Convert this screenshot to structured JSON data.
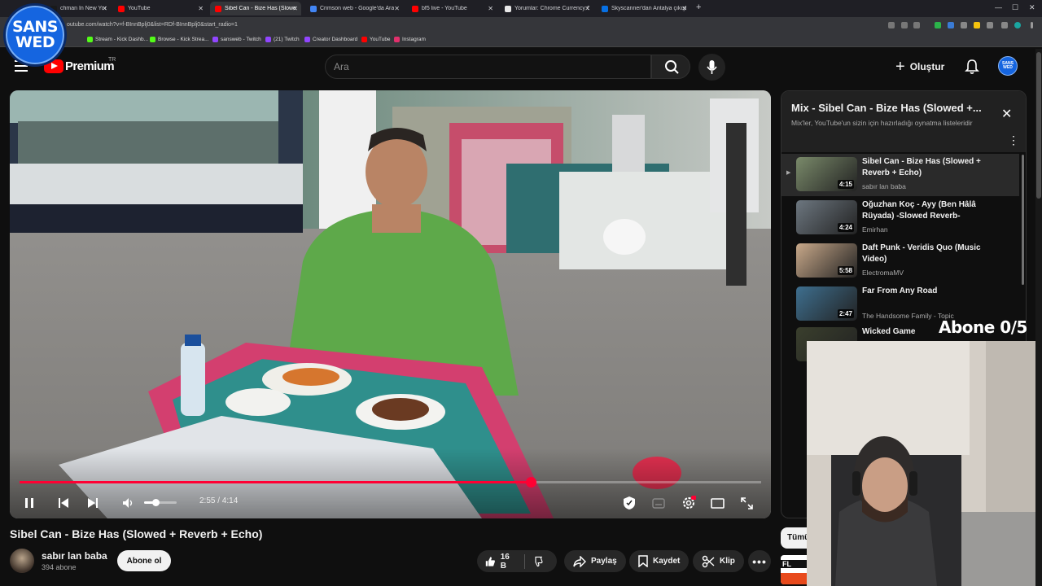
{
  "browser": {
    "tabs": [
      {
        "title": "chman In New Yor",
        "color": "#1a1a1a"
      },
      {
        "title": "YouTube",
        "color": "#ff0000"
      },
      {
        "title": "Sibel Can - Bize Has (Slowe",
        "color": "#ff0000"
      },
      {
        "title": "Crimson web - Google'da Ara",
        "color": "#4285f4"
      },
      {
        "title": "bf5 live - YouTube",
        "color": "#ff0000"
      },
      {
        "title": "Yorumlar: Chrome Currency Co",
        "color": "#e8e8e8"
      },
      {
        "title": "Skyscanner'dan Antalya çıkışl",
        "color": "#0770e3"
      }
    ],
    "new_tab": "+",
    "url": "outube.com/watch?v=f-BInnBplj0&list=RDf-BInnBplj0&start_radio=1",
    "bookmarks": [
      {
        "label": "Stream - Kick Dashb...",
        "color": "#53fc18"
      },
      {
        "label": "Browse - Kick Strea...",
        "color": "#53fc18"
      },
      {
        "label": "sansweb - Twitch",
        "color": "#9146ff"
      },
      {
        "label": "(21) Twitch",
        "color": "#9146ff"
      },
      {
        "label": "Creator Dashboard",
        "color": "#9146ff"
      },
      {
        "label": "YouTube",
        "color": "#ff0000"
      },
      {
        "label": "Instagram",
        "color": "#e1306c"
      }
    ]
  },
  "logo_overlay": {
    "line1": "SANS",
    "line2": "WED"
  },
  "header": {
    "brand": "Premium",
    "country": "TR",
    "search_placeholder": "Ara",
    "create_label": "Oluştur",
    "avatar_text": "SANS WED"
  },
  "player": {
    "current_time": "2:55",
    "duration": "4:14",
    "time_display": "2:55 / 4:14",
    "progress_fraction": 0.689,
    "volume_fraction": 0.35
  },
  "video": {
    "title": "Sibel Can - Bize Has (Slowed + Reverb + Echo)",
    "channel": "sabır lan baba",
    "subscribers": "394 abone",
    "subscribe_label": "Abone ol",
    "likes": "16 B",
    "share_label": "Paylaş",
    "save_label": "Kaydet",
    "clip_label": "Klip"
  },
  "playlist": {
    "title": "Mix - Sibel Can - Bize Has (Slowed +...",
    "subtitle": "Mix'ler, YouTube'un sizin için hazırladığı oynatma listeleridir",
    "items": [
      {
        "title": "Sibel Can - Bize Has (Slowed + Reverb + Echo)",
        "channel": "sabır lan baba",
        "duration": "4:15",
        "current": true,
        "thumb": "#7a8a6a"
      },
      {
        "title": "Oğuzhan Koç - Ayy (Ben Hâlâ Rüyada) -Slowed Reverb-",
        "channel": "Emirhan",
        "duration": "4:24",
        "current": false,
        "thumb": "#6d7780"
      },
      {
        "title": "Daft Punk - Veridis Quo (Music Video)",
        "channel": "ElectromaMV",
        "duration": "5:58",
        "current": false,
        "thumb": "#c9a98a"
      },
      {
        "title": "Far From Any Road",
        "channel": "The Handsome Family - Topic",
        "duration": "2:47",
        "current": false,
        "thumb": "#3e6f8f"
      },
      {
        "title": "Wicked Game",
        "channel": "",
        "duration": "",
        "current": false,
        "thumb": "#3a3f2d"
      }
    ]
  },
  "overlay": {
    "abone_counter": "Abone 0/5"
  },
  "chips": {
    "all": "Tümü"
  }
}
